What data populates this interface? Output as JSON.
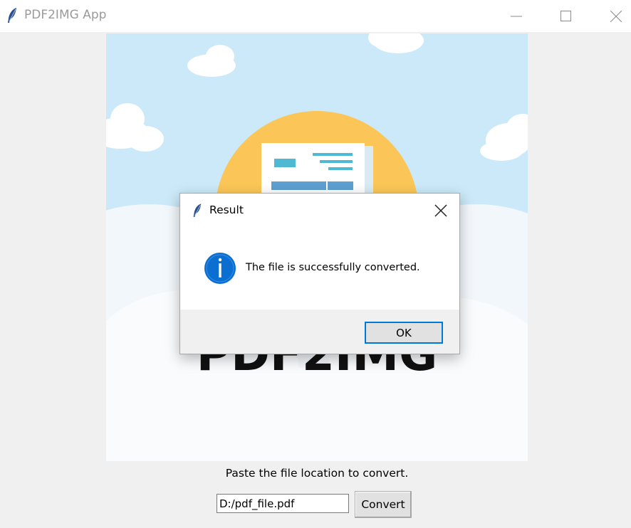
{
  "window": {
    "title": "PDF2IMG App",
    "app_icon": "feather-icon",
    "controls": {
      "minimize": "minimize-icon",
      "maximize": "maximize-icon",
      "close": "close-icon"
    }
  },
  "banner": {
    "logo_text": "PDF2IMG",
    "colors": {
      "sky": "#cbe9f8",
      "sun": "#fbc657",
      "cloud": "#f2f7fb",
      "document_accent": "#4fb9d4"
    }
  },
  "form": {
    "instruction": "Paste the file location to convert.",
    "path_value": "D:/pdf_file.pdf",
    "convert_label": "Convert"
  },
  "dialog": {
    "title": "Result",
    "message": "The file is successfully converted.",
    "ok_label": "OK",
    "info_icon": "info-icon",
    "colors": {
      "info": "#0a6fd1",
      "focus_border": "#0078d7"
    }
  }
}
